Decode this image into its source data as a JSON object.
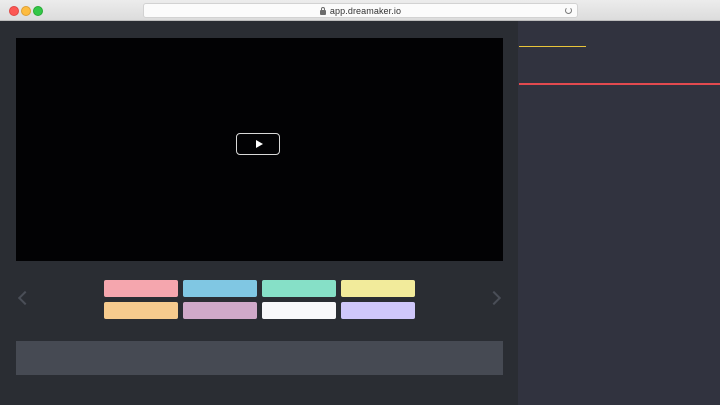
{
  "browser": {
    "url": "app.dreamaker.io"
  },
  "palette": {
    "swatches": [
      {
        "name": "pink",
        "color": "#f5a6ae"
      },
      {
        "name": "sky",
        "color": "#80c7e3"
      },
      {
        "name": "mint",
        "color": "#86e0c7"
      },
      {
        "name": "lemon",
        "color": "#f2eb9b"
      },
      {
        "name": "peach",
        "color": "#f6cb8e"
      },
      {
        "name": "mauve",
        "color": "#d0a9c9"
      },
      {
        "name": "white",
        "color": "#f8f8fa"
      },
      {
        "name": "lavender",
        "color": "#cfc7fa"
      }
    ]
  },
  "accents": {
    "yellow_line": "#e9c53a",
    "red_line": "#e24a4f"
  }
}
